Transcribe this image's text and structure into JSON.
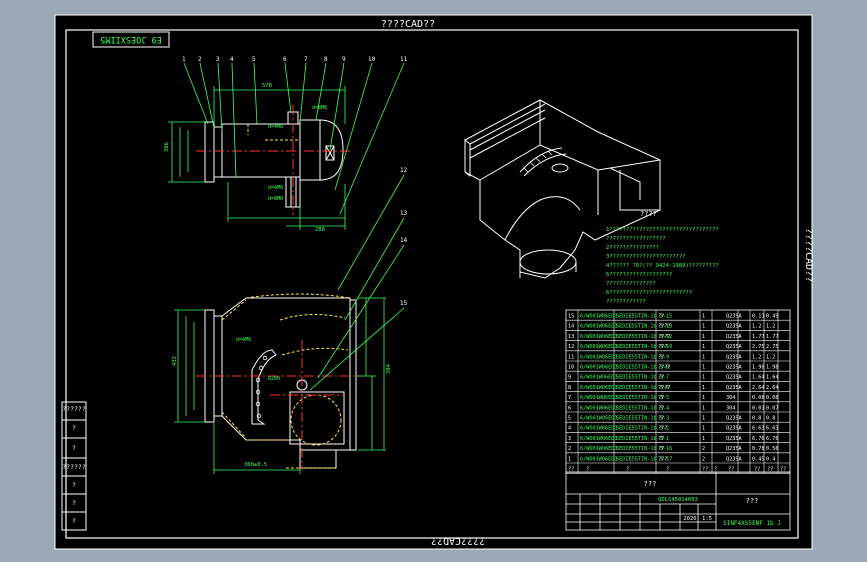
{
  "frame": {
    "top_title": "????CAD??",
    "bottom_title": "????CAD??",
    "right_title": "????CAD??",
    "drawing_no": "E9 JOESXIIM5"
  },
  "colors": {
    "background": "#000000",
    "outer_bg": "#9aa9b5",
    "line": "#ffffff",
    "dim": "#3cff5a",
    "hidden": "#ffe24a",
    "center": "#ff3030",
    "text": "#ffffff"
  },
  "part_numbers_top": [
    "1",
    "2",
    "3",
    "4",
    "5",
    "6",
    "7",
    "8",
    "9",
    "10",
    "11"
  ],
  "part_numbers_right": [
    "12",
    "13",
    "14",
    "15"
  ],
  "left_sidebar": [
    "??????",
    "?",
    "?",
    "??????",
    "?",
    "?",
    "?"
  ],
  "notes": {
    "heading": "????",
    "lines": [
      "1?????????????????????????????????",
      "  ??????????????????",
      "2???????????????",
      "3???????????????????????",
      "4?????? ?D?(?? 9424-1989)?????????",
      "5???????????????????",
      "  ???????????????",
      "6?????????????????????????",
      "  ????????????"
    ]
  },
  "bom": {
    "rows": [
      {
        "no": "15",
        "code": "6/WO01WO6ED1",
        "name": "SEDIE55TIN-1b 3-15",
        "spec": "??",
        "qty": "1",
        "mat": "Q235A",
        "unit": "0.11",
        "total": "0.49"
      },
      {
        "no": "14",
        "code": "6/WO01WO6ED1",
        "name": "SEDIE55TIN-1b 3-13",
        "spec": "????",
        "qty": "1",
        "mat": "Q235A",
        "unit": "1.2",
        "total": "1.2"
      },
      {
        "no": "13",
        "code": "6/WO01WO6ED1",
        "name": "SEDIE55TIN-1b 3-12",
        "spec": "????",
        "qty": "1",
        "mat": "Q235A",
        "unit": "1.77",
        "total": "1.77"
      },
      {
        "no": "12",
        "code": "6/WO01WO6ED1",
        "name": "SEDIE55TIN-1b 3-10",
        "spec": "???",
        "qty": "1",
        "mat": "Q235A",
        "unit": "2.75",
        "total": "2.75"
      },
      {
        "no": "11",
        "code": "6/WO01WO6ED1",
        "name": "SEDIE55TIN-1b 3-9",
        "spec": "??",
        "qty": "1",
        "mat": "Q235A",
        "unit": "1.2",
        "total": "1.2"
      },
      {
        "no": "10",
        "code": "6/WO01WO6ED1",
        "name": "SEDIE55TIN-1b 3-8",
        "spec": "????",
        "qty": "1",
        "mat": "Q235A",
        "unit": "1.98",
        "total": "1.98"
      },
      {
        "no": "9",
        "code": "6/WO01WO6ED1",
        "name": "SEDIE55TIN-1b 3-7",
        "spec": "??",
        "qty": "1",
        "mat": "Q235A",
        "unit": "1.64",
        "total": "1.64"
      },
      {
        "no": "8",
        "code": "6/WO01WO6ED1",
        "name": "SEDIE55TIN-1b 3-6",
        "spec": "????",
        "qty": "1",
        "mat": "Q235A",
        "unit": "2.64",
        "total": "2.64"
      },
      {
        "no": "7",
        "code": "6/WO01WO6ED1",
        "name": "SEDIE55TIN-1b 3-5",
        "spec": "??",
        "qty": "1",
        "mat": "304",
        "unit": "0.08",
        "total": "0.08"
      },
      {
        "no": "6",
        "code": "6/WO01WO6ED1",
        "name": "SEDIE55TIN-1b 3-4",
        "spec": "??",
        "qty": "1",
        "mat": "304",
        "unit": "0.01",
        "total": "0.07"
      },
      {
        "no": "5",
        "code": "6/WO01WO6ED1",
        "name": "SEDIE55TIN-1b 3-3",
        "spec": "??",
        "qty": "1",
        "mat": "Q235A",
        "unit": "0.8",
        "total": "0.8"
      },
      {
        "no": "4",
        "code": "6/WO01WO6ED1",
        "name": "SEDIE55TIN-1b 3-2",
        "spec": "???",
        "qty": "1",
        "mat": "Q235A",
        "unit": "6.63",
        "total": "6.63"
      },
      {
        "no": "3",
        "code": "6/WO01WO6ED1",
        "name": "SEDIE55TIN-1b 3-1",
        "spec": "??",
        "qty": "1",
        "mat": "Q235A",
        "unit": "6.76",
        "total": "6.76"
      },
      {
        "no": "2",
        "code": "6/WO01WO6ED1",
        "name": "SEDIE55TIN-1b 3-16",
        "spec": "??",
        "qty": "2",
        "mat": "Q235A",
        "unit": "0.78",
        "total": "0.56"
      },
      {
        "no": "1",
        "code": "6/WO01WO6ED1",
        "name": "SEDIE55TIN-1b 3-17",
        "spec": "???",
        "qty": "2",
        "mat": "Q235A",
        "unit": "0.45",
        "total": "0.4"
      }
    ],
    "header": [
      "??",
      "?",
      "?",
      "?",
      "??",
      "?",
      "??",
      "??",
      "??",
      "??"
    ]
  },
  "title_block": {
    "name": "???",
    "material": "???",
    "code": "QDLS45014003",
    "drawing": "SINF4XS5ENF 1b J",
    "scale": "1:5",
    "date": "2026"
  }
}
